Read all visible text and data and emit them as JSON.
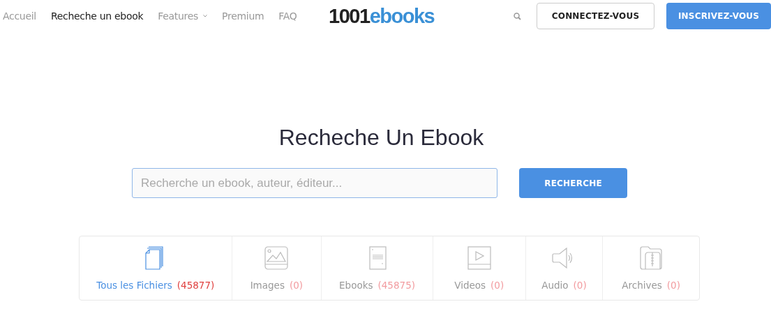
{
  "nav": {
    "items": [
      {
        "label": "Accueil",
        "selected": false,
        "dropdown": false
      },
      {
        "label": "Recheche un ebook",
        "selected": true,
        "dropdown": false
      },
      {
        "label": "Features",
        "selected": false,
        "dropdown": true
      },
      {
        "label": "Premium",
        "selected": false,
        "dropdown": false
      },
      {
        "label": "FAQ",
        "selected": false,
        "dropdown": false
      }
    ],
    "logo": {
      "prefix": "1001",
      "suffix": "ebooks"
    },
    "login": "CONNECTEZ-VOUS",
    "signup": "INSCRIVEZ-VOUS"
  },
  "search": {
    "title": "Recheche Un Ebook",
    "placeholder": "Recherche un ebook, auteur, éditeur...",
    "button": "RECHERCHE"
  },
  "tabs": [
    {
      "kind": "files",
      "label": "Tous les Fichiers",
      "count": "(45877)",
      "selected": true
    },
    {
      "kind": "images",
      "label": "Images",
      "count": "(0)",
      "selected": false
    },
    {
      "kind": "ebooks",
      "label": "Ebooks",
      "count": "(45875)",
      "selected": false
    },
    {
      "kind": "videos",
      "label": "Videos",
      "count": "(0)",
      "selected": false
    },
    {
      "kind": "audio",
      "label": "Audio",
      "count": "(0)",
      "selected": false
    },
    {
      "kind": "archives",
      "label": "Archives",
      "count": "(0)",
      "selected": false
    }
  ]
}
